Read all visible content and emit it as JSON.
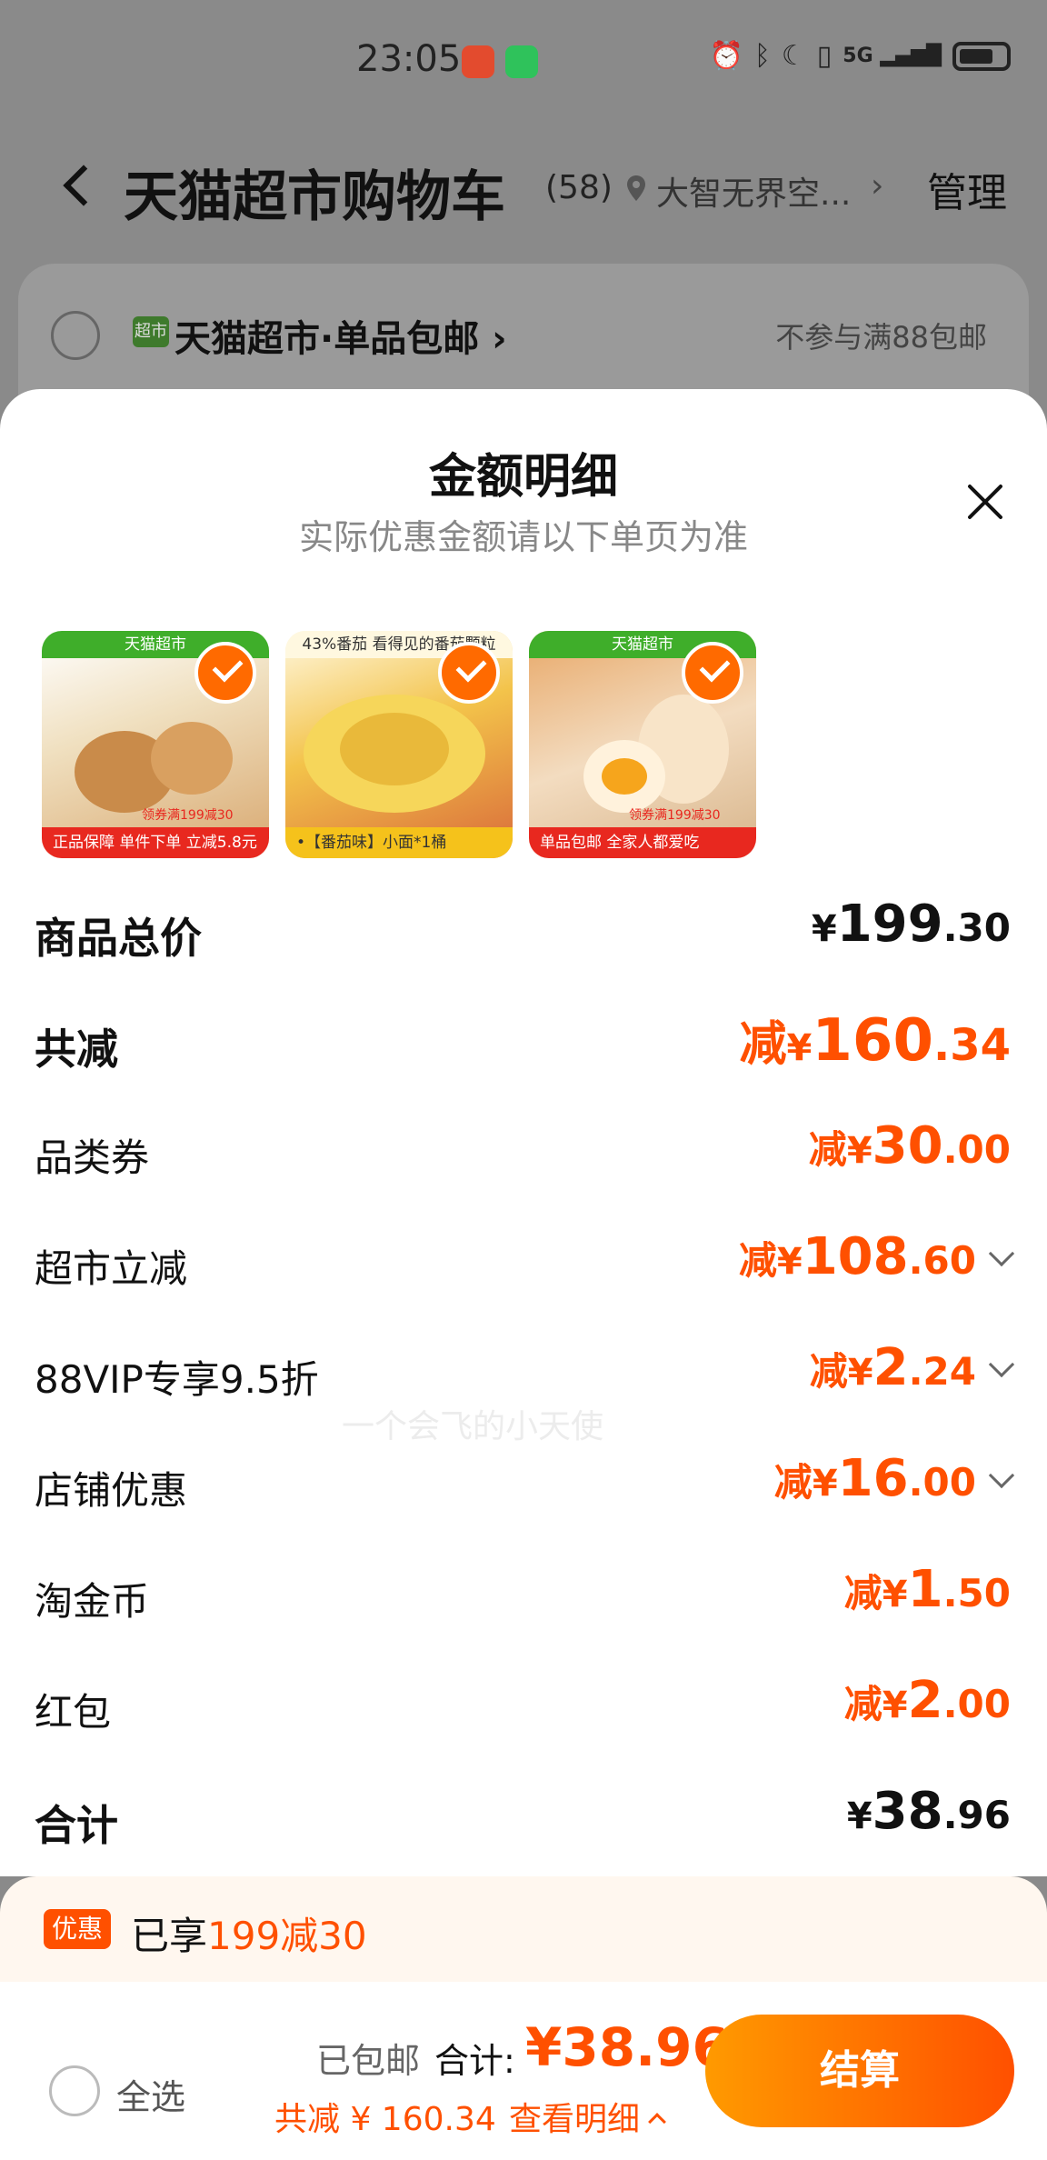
{
  "status_bar": {
    "time": "23:05",
    "icons": [
      "zhi-app-icon",
      "wechat-icon",
      "alarm-icon",
      "bluetooth-icon",
      "moon-icon",
      "vibrate-icon",
      "5g-signal-icon",
      "battery-icon"
    ],
    "network": "5G"
  },
  "header": {
    "title": "天猫超市购物车",
    "count": "(58)",
    "location": "大智无界空...",
    "chevron": "›",
    "manage_label": "管理"
  },
  "shop": {
    "badge": "超市",
    "name": "天猫超市·单品包邮 ›",
    "note": "不参与满88包邮"
  },
  "sheet": {
    "title": "金额明细",
    "subtitle": "实际优惠金额请以下单页为准",
    "watermark": "一个会飞的小天使",
    "products": [
      {
        "banner": "天猫超市",
        "footer": "单件下单 立减5.8元",
        "footer_left": "正品保障",
        "coupon": "领券满199减30"
      },
      {
        "banner": "43%番茄 看得见的番茄颗粒",
        "footer": "•【番茄味】小面*1桶",
        "footer_left": "",
        "coupon": ""
      },
      {
        "banner": "天猫超市",
        "footer": "全家人都爱吃",
        "footer_left": "单品包邮",
        "coupon": "领券满199减30"
      }
    ],
    "rows": [
      {
        "label": "商品总价",
        "prefix": "",
        "currency": "¥",
        "int": "199",
        "dec": ".30",
        "expandable": false
      },
      {
        "label": "共减",
        "prefix": "减",
        "currency": "¥",
        "int": "160",
        "dec": ".34",
        "expandable": false
      },
      {
        "label": "品类券",
        "prefix": "减",
        "currency": "¥",
        "int": "30",
        "dec": ".00",
        "expandable": false
      },
      {
        "label": "超市立减",
        "prefix": "减",
        "currency": "¥",
        "int": "108",
        "dec": ".60",
        "expandable": true
      },
      {
        "label": "88VIP专享9.5折",
        "prefix": "减",
        "currency": "¥",
        "int": "2",
        "dec": ".24",
        "expandable": true
      },
      {
        "label": "店铺优惠",
        "prefix": "减",
        "currency": "¥",
        "int": "16",
        "dec": ".00",
        "expandable": true
      },
      {
        "label": "淘金币",
        "prefix": "减",
        "currency": "¥",
        "int": "1",
        "dec": ".50",
        "expandable": false
      },
      {
        "label": "红包",
        "prefix": "减",
        "currency": "¥",
        "int": "2",
        "dec": ".00",
        "expandable": false
      },
      {
        "label": "合计",
        "prefix": "",
        "currency": "¥",
        "int": "38",
        "dec": ".96",
        "expandable": false
      }
    ]
  },
  "promo": {
    "tag": "优惠",
    "text_prefix": "已享",
    "text_highlight": "199减30"
  },
  "bottom": {
    "select_all": "全选",
    "shipping": "已包邮",
    "total_label": "合计:",
    "total_value": "¥38.96",
    "discount": "共减 ¥ 160.34",
    "detail_link": "查看明细",
    "checkout": "结算"
  },
  "colors": {
    "accent": "#ff5000",
    "checkout_gradient_start": "#ff9a00",
    "checkout_gradient_end": "#ff5000"
  }
}
